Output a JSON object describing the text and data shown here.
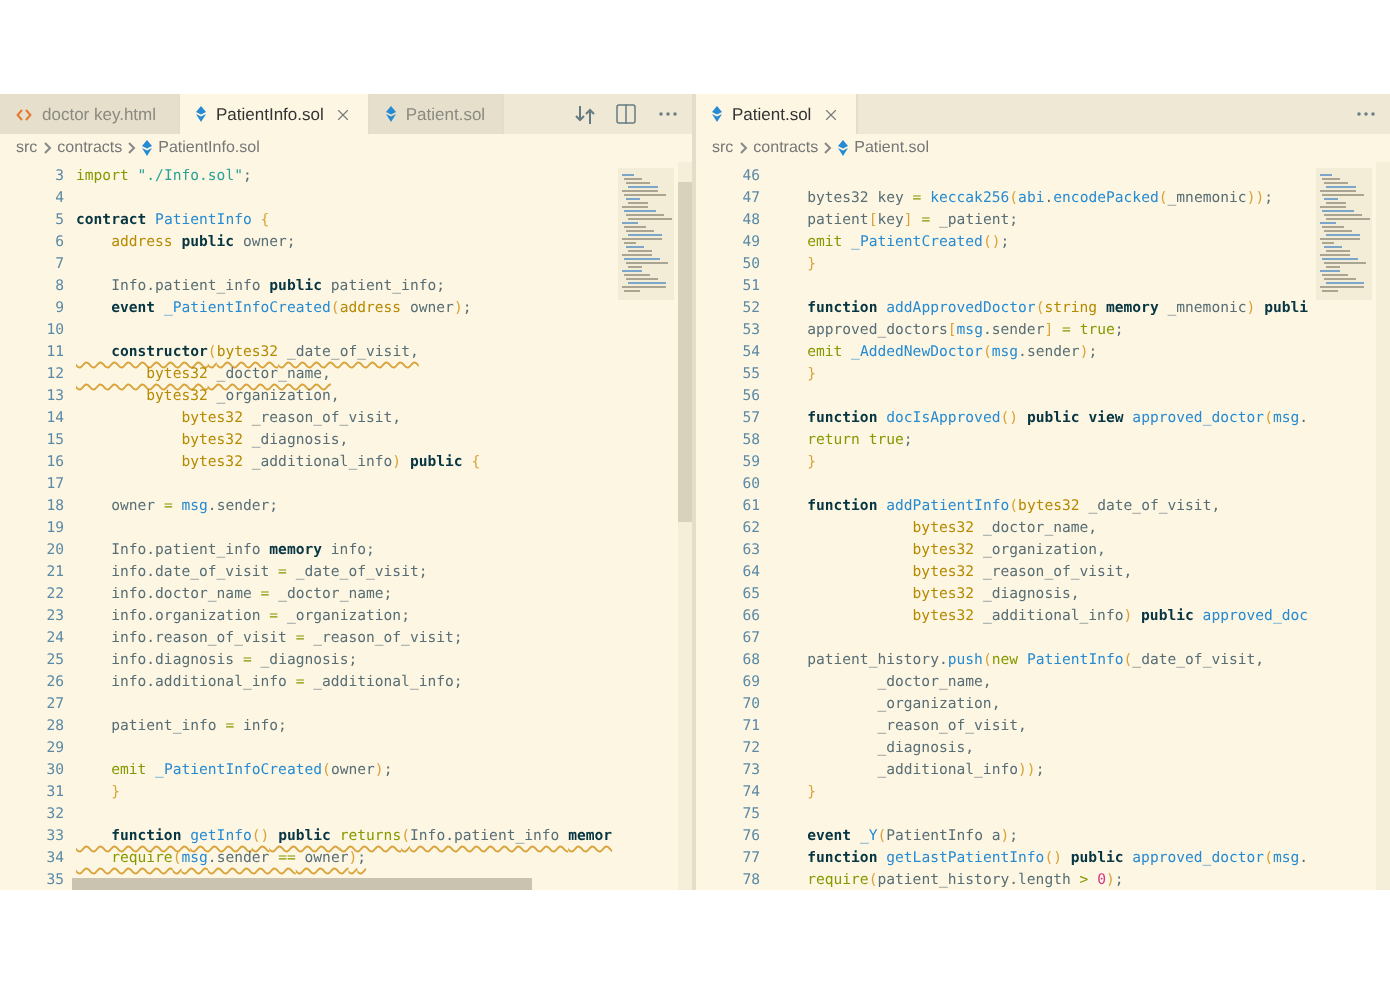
{
  "panes": [
    {
      "tabs": [
        {
          "label": "doctor key.html",
          "kind": "html",
          "selected": false
        },
        {
          "label": "PatientInfo.sol",
          "kind": "solidity",
          "selected": true,
          "closable": true
        },
        {
          "label": "Patient.sol",
          "kind": "solidity",
          "selected": false
        }
      ],
      "actions": [
        {
          "kind": "compare"
        },
        {
          "kind": "split"
        },
        {
          "kind": "more"
        }
      ],
      "breadcrumb": [
        "src",
        "contracts",
        "PatientInfo.sol"
      ],
      "lines": [
        {
          "n": "3",
          "tokens": [
            {
              "kind": "c",
              "text": "import "
            },
            {
              "kind": "s",
              "text": "\"./Info.sol\""
            },
            {
              "kind": "p",
              "text": ";"
            }
          ]
        },
        {
          "n": "4"
        },
        {
          "n": "5",
          "tokens": [
            {
              "kind": "k",
              "text": "contract "
            },
            {
              "kind": "f",
              "text": "PatientInfo "
            },
            {
              "kind": "b",
              "text": "{"
            }
          ]
        },
        {
          "n": "6",
          "tokens": [
            {
              "kind": "t",
              "text": "    address "
            },
            {
              "kind": "k",
              "text": "public"
            },
            {
              "kind": "p",
              "text": " owner;"
            }
          ]
        },
        {
          "n": "7"
        },
        {
          "n": "8",
          "tokens": [
            {
              "kind": "p",
              "text": "    Info.patient_info "
            },
            {
              "kind": "k",
              "text": "public"
            },
            {
              "kind": "p",
              "text": " patient_info;"
            }
          ]
        },
        {
          "n": "9",
          "tokens": [
            {
              "kind": "k",
              "text": "    event "
            },
            {
              "kind": "f",
              "text": "_PatientInfoCreated"
            },
            {
              "kind": "b",
              "text": "("
            },
            {
              "kind": "t",
              "text": "address"
            },
            {
              "kind": "p",
              "text": " owner"
            },
            {
              "kind": "b",
              "text": ")"
            },
            {
              "kind": "p",
              "text": ";"
            }
          ]
        },
        {
          "n": "10"
        },
        {
          "n": "11",
          "squiggle": true,
          "tokens": [
            {
              "kind": "k",
              "text": "    constructor"
            },
            {
              "kind": "b",
              "text": "("
            },
            {
              "kind": "t",
              "text": "bytes32"
            },
            {
              "kind": "p",
              "text": " _date_of_visit,"
            }
          ]
        },
        {
          "n": "12",
          "squiggle": true,
          "tokens": [
            {
              "kind": "t",
              "text": "        bytes32"
            },
            {
              "kind": "p",
              "text": " _doctor_name,"
            }
          ]
        },
        {
          "n": "13",
          "tokens": [
            {
              "kind": "t",
              "text": "        bytes32"
            },
            {
              "kind": "p",
              "text": " _organization,"
            }
          ]
        },
        {
          "n": "14",
          "tokens": [
            {
              "kind": "t",
              "text": "            bytes32"
            },
            {
              "kind": "p",
              "text": " _reason_of_visit,"
            }
          ]
        },
        {
          "n": "15",
          "tokens": [
            {
              "kind": "t",
              "text": "            bytes32"
            },
            {
              "kind": "p",
              "text": " _diagnosis,"
            }
          ]
        },
        {
          "n": "16",
          "tokens": [
            {
              "kind": "t",
              "text": "            bytes32"
            },
            {
              "kind": "p",
              "text": " _additional_info"
            },
            {
              "kind": "b",
              "text": ")"
            },
            {
              "kind": "k",
              "text": " public"
            },
            {
              "kind": "b",
              "text": " {"
            }
          ]
        },
        {
          "n": "17"
        },
        {
          "n": "18",
          "tokens": [
            {
              "kind": "p",
              "text": "    owner "
            },
            {
              "kind": "o",
              "text": "="
            },
            {
              "kind": "v",
              "text": " msg"
            },
            {
              "kind": "p",
              "text": ".sender;"
            }
          ]
        },
        {
          "n": "19"
        },
        {
          "n": "20",
          "tokens": [
            {
              "kind": "p",
              "text": "    Info.patient_info "
            },
            {
              "kind": "k",
              "text": "memory"
            },
            {
              "kind": "p",
              "text": " info;"
            }
          ]
        },
        {
          "n": "21",
          "tokens": [
            {
              "kind": "p",
              "text": "    info.date_of_visit "
            },
            {
              "kind": "o",
              "text": "="
            },
            {
              "kind": "p",
              "text": " _date_of_visit;"
            }
          ]
        },
        {
          "n": "22",
          "tokens": [
            {
              "kind": "p",
              "text": "    info.doctor_name "
            },
            {
              "kind": "o",
              "text": "="
            },
            {
              "kind": "p",
              "text": " _doctor_name;"
            }
          ]
        },
        {
          "n": "23",
          "tokens": [
            {
              "kind": "p",
              "text": "    info.organization "
            },
            {
              "kind": "o",
              "text": "="
            },
            {
              "kind": "p",
              "text": " _organization;"
            }
          ]
        },
        {
          "n": "24",
          "tokens": [
            {
              "kind": "p",
              "text": "    info.reason_of_visit "
            },
            {
              "kind": "o",
              "text": "="
            },
            {
              "kind": "p",
              "text": " _reason_of_visit;"
            }
          ]
        },
        {
          "n": "25",
          "tokens": [
            {
              "kind": "p",
              "text": "    info.diagnosis "
            },
            {
              "kind": "o",
              "text": "="
            },
            {
              "kind": "p",
              "text": " _diagnosis;"
            }
          ]
        },
        {
          "n": "26",
          "tokens": [
            {
              "kind": "p",
              "text": "    info.additional_info "
            },
            {
              "kind": "o",
              "text": "="
            },
            {
              "kind": "p",
              "text": " _additional_info;"
            }
          ]
        },
        {
          "n": "27"
        },
        {
          "n": "28",
          "tokens": [
            {
              "kind": "p",
              "text": "    patient_info "
            },
            {
              "kind": "o",
              "text": "="
            },
            {
              "kind": "p",
              "text": " info;"
            }
          ]
        },
        {
          "n": "29"
        },
        {
          "n": "30",
          "tokens": [
            {
              "kind": "c",
              "text": "    emit "
            },
            {
              "kind": "f",
              "text": "_PatientInfoCreated"
            },
            {
              "kind": "b",
              "text": "("
            },
            {
              "kind": "p",
              "text": "owner"
            },
            {
              "kind": "b",
              "text": ")"
            },
            {
              "kind": "p",
              "text": ";"
            }
          ]
        },
        {
          "n": "31",
          "tokens": [
            {
              "kind": "b",
              "text": "    }"
            }
          ]
        },
        {
          "n": "32"
        },
        {
          "n": "33",
          "squiggle": true,
          "tokens": [
            {
              "kind": "k",
              "text": "    function "
            },
            {
              "kind": "f",
              "text": "getInfo"
            },
            {
              "kind": "b",
              "text": "()"
            },
            {
              "kind": "k",
              "text": " public "
            },
            {
              "kind": "c",
              "text": "returns"
            },
            {
              "kind": "b",
              "text": "("
            },
            {
              "kind": "p",
              "text": "Info.patient_info "
            },
            {
              "kind": "k",
              "text": "memor"
            }
          ]
        },
        {
          "n": "34",
          "squiggle": true,
          "tokens": [
            {
              "kind": "c",
              "text": "    require"
            },
            {
              "kind": "b",
              "text": "("
            },
            {
              "kind": "v",
              "text": "msg"
            },
            {
              "kind": "p",
              "text": ".sender "
            },
            {
              "kind": "o",
              "text": "=="
            },
            {
              "kind": "p",
              "text": " owner"
            },
            {
              "kind": "b",
              "text": ")"
            },
            {
              "kind": "p",
              "text": ";"
            }
          ]
        },
        {
          "n": "35"
        }
      ]
    },
    {
      "tabs": [
        {
          "label": "Patient.sol",
          "kind": "solidity",
          "selected": true,
          "closable": true
        }
      ],
      "actions": [
        {
          "kind": "more"
        }
      ],
      "breadcrumb": [
        "src",
        "contracts",
        "Patient.sol"
      ],
      "lines": [
        {
          "n": "46"
        },
        {
          "n": "47",
          "tokens": [
            {
              "kind": "p",
              "text": "    bytes32 key "
            },
            {
              "kind": "o",
              "text": "="
            },
            {
              "kind": "f",
              "text": " keccak256"
            },
            {
              "kind": "b",
              "text": "("
            },
            {
              "kind": "v",
              "text": "abi"
            },
            {
              "kind": "p",
              "text": "."
            },
            {
              "kind": "f",
              "text": "encodePacked"
            },
            {
              "kind": "b",
              "text": "("
            },
            {
              "kind": "p",
              "text": "_mnemonic"
            },
            {
              "kind": "b",
              "text": "))"
            },
            {
              "kind": "p",
              "text": ";"
            }
          ]
        },
        {
          "n": "48",
          "tokens": [
            {
              "kind": "p",
              "text": "    patient"
            },
            {
              "kind": "b",
              "text": "["
            },
            {
              "kind": "p",
              "text": "key"
            },
            {
              "kind": "b",
              "text": "]"
            },
            {
              "kind": "o",
              "text": " ="
            },
            {
              "kind": "p",
              "text": " _patient;"
            }
          ]
        },
        {
          "n": "49",
          "tokens": [
            {
              "kind": "c",
              "text": "    emit "
            },
            {
              "kind": "f",
              "text": "_PatientCreated"
            },
            {
              "kind": "b",
              "text": "()"
            },
            {
              "kind": "p",
              "text": ";"
            }
          ]
        },
        {
          "n": "50",
          "tokens": [
            {
              "kind": "b",
              "text": "    }"
            }
          ]
        },
        {
          "n": "51"
        },
        {
          "n": "52",
          "tokens": [
            {
              "kind": "k",
              "text": "    function "
            },
            {
              "kind": "f",
              "text": "addApprovedDoctor"
            },
            {
              "kind": "b",
              "text": "("
            },
            {
              "kind": "t",
              "text": "string "
            },
            {
              "kind": "k",
              "text": "memory"
            },
            {
              "kind": "p",
              "text": " _mnemonic"
            },
            {
              "kind": "b",
              "text": ")"
            },
            {
              "kind": "k",
              "text": " publi"
            }
          ]
        },
        {
          "n": "53",
          "tokens": [
            {
              "kind": "p",
              "text": "    approved_doctors"
            },
            {
              "kind": "b",
              "text": "["
            },
            {
              "kind": "v",
              "text": "msg"
            },
            {
              "kind": "p",
              "text": ".sender"
            },
            {
              "kind": "b",
              "text": "]"
            },
            {
              "kind": "o",
              "text": " ="
            },
            {
              "kind": "c",
              "text": " true"
            },
            {
              "kind": "p",
              "text": ";"
            }
          ]
        },
        {
          "n": "54",
          "tokens": [
            {
              "kind": "c",
              "text": "    emit "
            },
            {
              "kind": "f",
              "text": "_AddedNewDoctor"
            },
            {
              "kind": "b",
              "text": "("
            },
            {
              "kind": "v",
              "text": "msg"
            },
            {
              "kind": "p",
              "text": ".sender"
            },
            {
              "kind": "b",
              "text": ")"
            },
            {
              "kind": "p",
              "text": ";"
            }
          ]
        },
        {
          "n": "55",
          "tokens": [
            {
              "kind": "b",
              "text": "    }"
            }
          ]
        },
        {
          "n": "56"
        },
        {
          "n": "57",
          "tokens": [
            {
              "kind": "k",
              "text": "    function "
            },
            {
              "kind": "f",
              "text": "docIsApproved"
            },
            {
              "kind": "b",
              "text": "()"
            },
            {
              "kind": "k",
              "text": " public view "
            },
            {
              "kind": "f",
              "text": "approved_doctor"
            },
            {
              "kind": "b",
              "text": "("
            },
            {
              "kind": "v",
              "text": "msg"
            },
            {
              "kind": "p",
              "text": "."
            }
          ]
        },
        {
          "n": "58",
          "tokens": [
            {
              "kind": "c",
              "text": "    return true"
            },
            {
              "kind": "p",
              "text": ";"
            }
          ]
        },
        {
          "n": "59",
          "tokens": [
            {
              "kind": "b",
              "text": "    }"
            }
          ]
        },
        {
          "n": "60"
        },
        {
          "n": "61",
          "tokens": [
            {
              "kind": "k",
              "text": "    function "
            },
            {
              "kind": "f",
              "text": "addPatientInfo"
            },
            {
              "kind": "b",
              "text": "("
            },
            {
              "kind": "t",
              "text": "bytes32"
            },
            {
              "kind": "p",
              "text": " _date_of_visit,"
            }
          ]
        },
        {
          "n": "62",
          "tokens": [
            {
              "kind": "t",
              "text": "                bytes32"
            },
            {
              "kind": "p",
              "text": " _doctor_name,"
            }
          ]
        },
        {
          "n": "63",
          "tokens": [
            {
              "kind": "t",
              "text": "                bytes32"
            },
            {
              "kind": "p",
              "text": " _organization,"
            }
          ]
        },
        {
          "n": "64",
          "tokens": [
            {
              "kind": "t",
              "text": "                bytes32"
            },
            {
              "kind": "p",
              "text": " _reason_of_visit,"
            }
          ]
        },
        {
          "n": "65",
          "tokens": [
            {
              "kind": "t",
              "text": "                bytes32"
            },
            {
              "kind": "p",
              "text": " _diagnosis,"
            }
          ]
        },
        {
          "n": "66",
          "tokens": [
            {
              "kind": "t",
              "text": "                bytes32"
            },
            {
              "kind": "p",
              "text": " _additional_info"
            },
            {
              "kind": "b",
              "text": ")"
            },
            {
              "kind": "k",
              "text": " public "
            },
            {
              "kind": "f",
              "text": "approved_doc"
            }
          ]
        },
        {
          "n": "67"
        },
        {
          "n": "68",
          "tokens": [
            {
              "kind": "p",
              "text": "    patient_history."
            },
            {
              "kind": "f",
              "text": "push"
            },
            {
              "kind": "b",
              "text": "("
            },
            {
              "kind": "c",
              "text": "new "
            },
            {
              "kind": "f",
              "text": "PatientInfo"
            },
            {
              "kind": "b",
              "text": "("
            },
            {
              "kind": "p",
              "text": "_date_of_visit,"
            }
          ]
        },
        {
          "n": "69",
          "tokens": [
            {
              "kind": "p",
              "text": "            _doctor_name,"
            }
          ]
        },
        {
          "n": "70",
          "tokens": [
            {
              "kind": "p",
              "text": "            _organization,"
            }
          ]
        },
        {
          "n": "71",
          "tokens": [
            {
              "kind": "p",
              "text": "            _reason_of_visit,"
            }
          ]
        },
        {
          "n": "72",
          "tokens": [
            {
              "kind": "p",
              "text": "            _diagnosis,"
            }
          ]
        },
        {
          "n": "73",
          "tokens": [
            {
              "kind": "p",
              "text": "            _additional_info"
            },
            {
              "kind": "b",
              "text": "))"
            },
            {
              "kind": "p",
              "text": ";"
            }
          ]
        },
        {
          "n": "74",
          "tokens": [
            {
              "kind": "b",
              "text": "    }"
            }
          ]
        },
        {
          "n": "75"
        },
        {
          "n": "76",
          "tokens": [
            {
              "kind": "k",
              "text": "    event "
            },
            {
              "kind": "f",
              "text": "_Y"
            },
            {
              "kind": "b",
              "text": "("
            },
            {
              "kind": "p",
              "text": "PatientInfo a"
            },
            {
              "kind": "b",
              "text": ")"
            },
            {
              "kind": "p",
              "text": ";"
            }
          ]
        },
        {
          "n": "77",
          "tokens": [
            {
              "kind": "k",
              "text": "    function "
            },
            {
              "kind": "f",
              "text": "getLastPatientInfo"
            },
            {
              "kind": "b",
              "text": "()"
            },
            {
              "kind": "k",
              "text": " public "
            },
            {
              "kind": "f",
              "text": "approved_doctor"
            },
            {
              "kind": "b",
              "text": "("
            },
            {
              "kind": "v",
              "text": "msg"
            },
            {
              "kind": "p",
              "text": "."
            }
          ]
        },
        {
          "n": "78",
          "tokens": [
            {
              "kind": "c",
              "text": "    require"
            },
            {
              "kind": "b",
              "text": "("
            },
            {
              "kind": "p",
              "text": "patient_history.length "
            },
            {
              "kind": "o",
              "text": ">"
            },
            {
              "kind": "m",
              "text": " 0"
            },
            {
              "kind": "b",
              "text": ")"
            },
            {
              "kind": "p",
              "text": ";"
            }
          ]
        }
      ]
    }
  ]
}
